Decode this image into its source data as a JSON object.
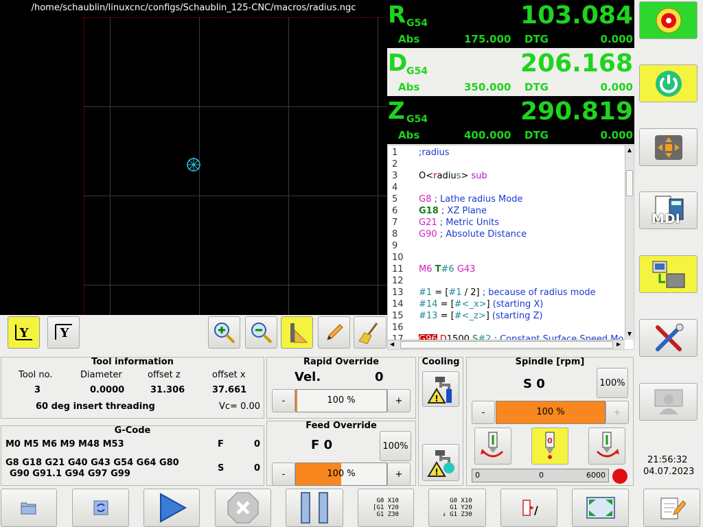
{
  "plot": {
    "file_path": "/home/schaublin/linuxcnc/configs/Schaublin_125-CNC/macros/radius.ngc"
  },
  "dro": [
    {
      "axis": "R",
      "coord": "G54",
      "value": "103.084",
      "abs_label": "Abs",
      "abs": "175.000",
      "dtg_label": "DTG",
      "dtg": "0.000"
    },
    {
      "axis": "D",
      "coord": "G54",
      "value": "206.168",
      "abs_label": "Abs",
      "abs": "350.000",
      "dtg_label": "DTG",
      "dtg": "0.000"
    },
    {
      "axis": "Z",
      "coord": "G54",
      "value": "290.819",
      "abs_label": "Abs",
      "abs": "400.000",
      "dtg_label": "DTG",
      "dtg": "0.000"
    }
  ],
  "editor": {
    "lines": [
      "1",
      "2",
      "3",
      "4",
      "5",
      "6",
      "7",
      "8",
      "9",
      "10",
      "11",
      "12",
      "13",
      "14",
      "15",
      "16",
      "17"
    ]
  },
  "tool": {
    "title": "Tool information",
    "h_no": "Tool no.",
    "h_dia": "Diameter",
    "h_oz": "offset z",
    "h_ox": "offset x",
    "no": "3",
    "dia": "0.0000",
    "oz": "31.306",
    "ox": "37.661",
    "desc": "60 deg insert threading",
    "vc": "Vc= 0.00"
  },
  "gcode": {
    "title": "G-Code",
    "m_codes": "M0 M5 M6 M9 M48 M53",
    "g_line1": "G8 G18 G21 G40 G43 G54 G64 G80",
    "g_line2": "G90 G91.1 G94 G97 G99",
    "f_label": "F",
    "f_val": "0",
    "s_label": "S",
    "s_val": "0"
  },
  "rapid": {
    "title": "Rapid Override",
    "label": "Vel.",
    "value": "0",
    "bar": "100 %",
    "minus": "-",
    "plus": "+"
  },
  "feed": {
    "title": "Feed Override",
    "label": "F  0",
    "reset": "100%",
    "bar": "100 %",
    "minus": "-",
    "plus": "+",
    "level": 0.5
  },
  "cooling": {
    "title": "Cooling"
  },
  "spindle": {
    "title": "Spindle [rpm]",
    "label": "S 0",
    "reset": "100%",
    "bar": "100 %",
    "minus": "-",
    "plus": "+",
    "min": "0",
    "cur": "0",
    "max": "6000"
  },
  "clock": {
    "time": "21:56:32",
    "date": "04.07.2023"
  },
  "side": {
    "mdi": "MDI"
  },
  "colors": {
    "dro_green": "#1ed41e",
    "active_yellow": "#f4f43e",
    "orange": "#f7871e",
    "estop_red": "#e01010"
  }
}
